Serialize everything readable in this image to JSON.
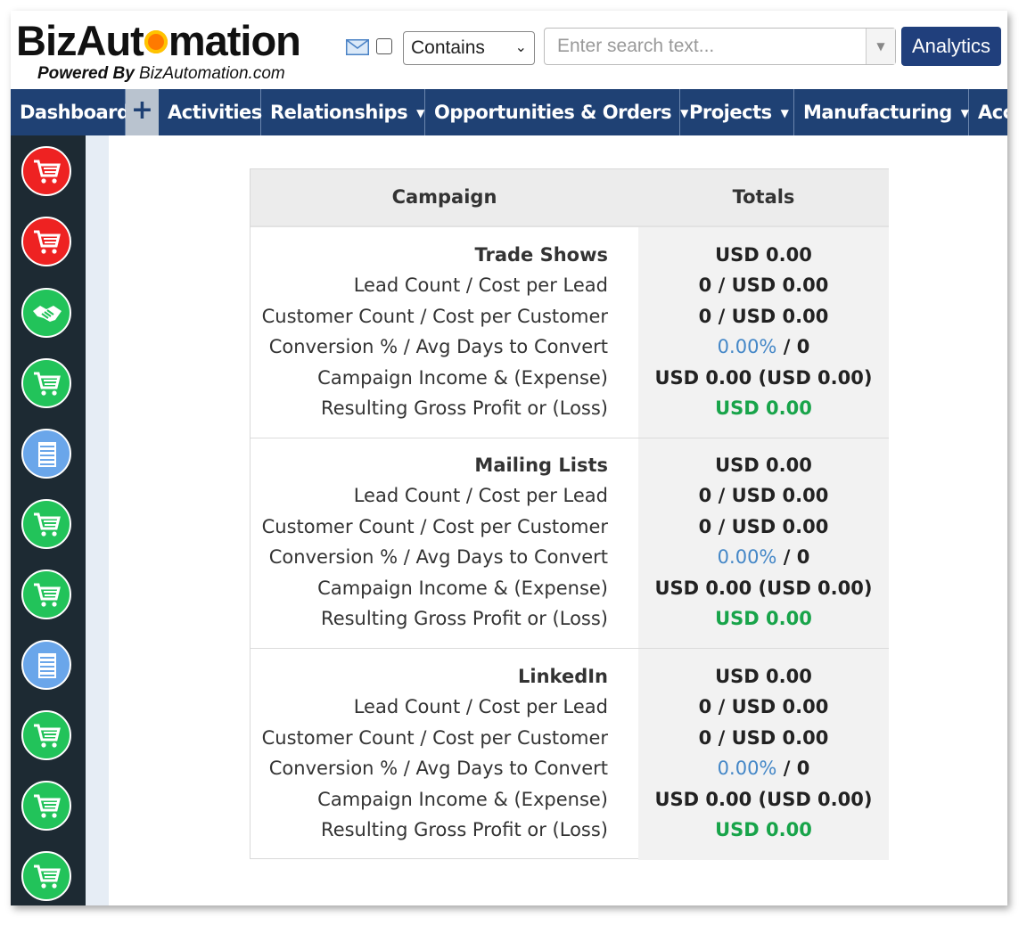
{
  "header": {
    "logo_text_before": "BizAut",
    "logo_text_after": "mation",
    "logo_powered_by": "Powered By",
    "logo_domain": "BizAutomation.com",
    "search_filter_value": "Contains",
    "search_placeholder": "Enter search text...",
    "analytics_label": "Analytics"
  },
  "nav": {
    "items": [
      {
        "label": "Dashboard"
      },
      {
        "label": "Activities"
      },
      {
        "label": "Relationships"
      },
      {
        "label": "Opportunities & Orders"
      },
      {
        "label": "Projects"
      },
      {
        "label": "Manufacturing"
      },
      {
        "label": "Acc"
      }
    ],
    "plus_label": "+"
  },
  "sidebar": {
    "icons": [
      {
        "name": "cart-icon",
        "color": "#ee2222"
      },
      {
        "name": "cart-icon",
        "color": "#ee2222"
      },
      {
        "name": "handshake-icon",
        "color": "#22c35a"
      },
      {
        "name": "cart-icon",
        "color": "#22c35a"
      },
      {
        "name": "building-icon",
        "color": "#6aa6ea"
      },
      {
        "name": "cart-icon",
        "color": "#22c35a"
      },
      {
        "name": "cart-icon",
        "color": "#22c35a"
      },
      {
        "name": "building-icon",
        "color": "#6aa6ea"
      },
      {
        "name": "cart-icon",
        "color": "#22c35a"
      },
      {
        "name": "cart-icon",
        "color": "#22c35a"
      },
      {
        "name": "cart-icon",
        "color": "#22c35a"
      }
    ]
  },
  "table": {
    "headers": {
      "campaign": "Campaign",
      "totals": "Totals"
    },
    "sections": [
      {
        "name": "Trade Shows",
        "total": "USD 0.00",
        "lead_label": "Lead Count / Cost per Lead",
        "lead_value": "0 / USD 0.00",
        "customer_label": "Customer Count / Cost per Customer",
        "customer_value": "0 / USD 0.00",
        "conversion_label": "Conversion % / Avg Days to Convert",
        "conversion_pct": "0.00%",
        "conversion_sep": " / ",
        "conversion_days": "0",
        "income_label": "Campaign Income & (Expense)",
        "income_value": "USD 0.00 (USD 0.00)",
        "profit_label": "Resulting Gross Profit or (Loss)",
        "profit_value": "USD 0.00"
      },
      {
        "name": "Mailing Lists",
        "total": "USD 0.00",
        "lead_label": "Lead Count / Cost per Lead",
        "lead_value": "0 / USD 0.00",
        "customer_label": "Customer Count / Cost per Customer",
        "customer_value": "0 / USD 0.00",
        "conversion_label": "Conversion % / Avg Days to Convert",
        "conversion_pct": "0.00%",
        "conversion_sep": " / ",
        "conversion_days": "0",
        "income_label": "Campaign Income & (Expense)",
        "income_value": "USD 0.00 (USD 0.00)",
        "profit_label": "Resulting Gross Profit or (Loss)",
        "profit_value": "USD 0.00"
      },
      {
        "name": "LinkedIn",
        "total": "USD 0.00",
        "lead_label": "Lead Count / Cost per Lead",
        "lead_value": "0 / USD 0.00",
        "customer_label": "Customer Count / Cost per Customer",
        "customer_value": "0 / USD 0.00",
        "conversion_label": "Conversion % / Avg Days to Convert",
        "conversion_pct": "0.00%",
        "conversion_sep": " / ",
        "conversion_days": "0",
        "income_label": "Campaign Income & (Expense)",
        "income_value": "USD 0.00 (USD 0.00)",
        "profit_label": "Resulting Gross Profit or (Loss)",
        "profit_value": "USD 0.00"
      }
    ]
  },
  "colors": {
    "nav_bg": "#1f4174",
    "sidebar_bg": "#1d2a33",
    "analytics_bg": "#203f7c",
    "percent_blue": "#4487c7",
    "profit_green": "#18a44a"
  }
}
